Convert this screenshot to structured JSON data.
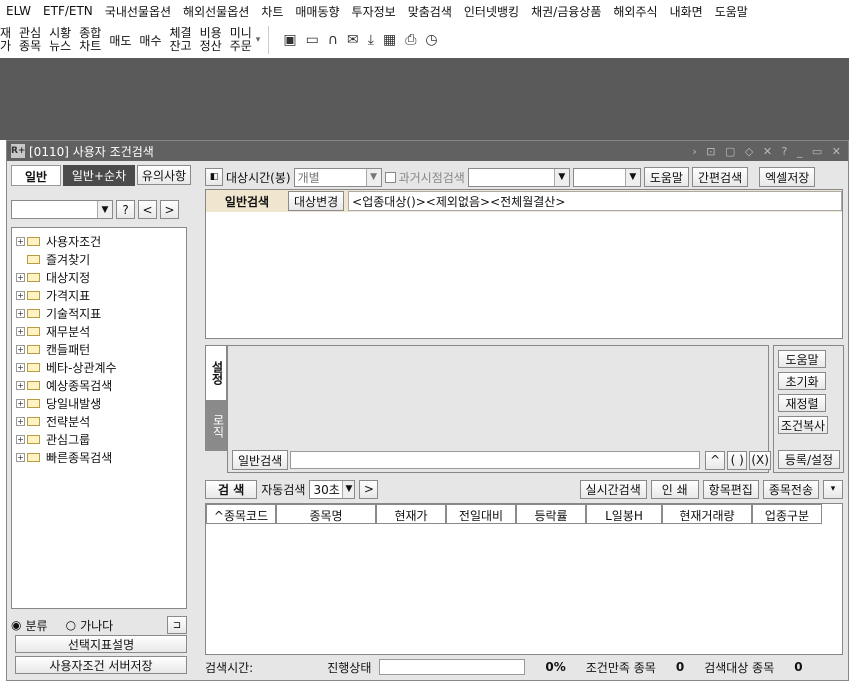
{
  "menu": [
    "ELW",
    "ETF/ETN",
    "국내선물옵션",
    "해외선물옵션",
    "차트",
    "매매동향",
    "투자정보",
    "맞춤검색",
    "인터넷뱅킹",
    "채권/금융상품",
    "해외주식",
    "내화면",
    "도움말"
  ],
  "toolbar": {
    "partial": "재\n가",
    "items": [
      "관심\n종목",
      "시황\n뉴스",
      "종합\n차트"
    ],
    "buy": "매도",
    "sell": "매수",
    "items2": [
      "체결\n잔고",
      "비용\n정산",
      "미니\n주문"
    ]
  },
  "window": {
    "title": "[0110] 사용자 조건검색",
    "logo": "R+",
    "controls": "› ⊡ ▢ ◇ ✕ ? _ ▭ ✕"
  },
  "left": {
    "tabs": [
      "일반",
      "일반+순차"
    ],
    "notice_btn": "유의사항",
    "help_q": "?",
    "nav_prev": "<",
    "nav_next": ">",
    "tree": [
      "사용자조건",
      "즐겨찾기",
      "대상지정",
      "가격지표",
      "기술적지표",
      "재무분석",
      "캔들패턴",
      "베타-상관계수",
      "예상종목검색",
      "당일내발생",
      "전략분석",
      "관심그룹",
      "빠른종목검색"
    ],
    "radio_a": "분류",
    "radio_b": "가나다",
    "btn_desc": "선택지표설명",
    "btn_save": "사용자조건 서버저장"
  },
  "top": {
    "target_time_label": "대상시간(봉)",
    "target_time_value": "개별",
    "past_search": "과거시점검색",
    "help": "도움말",
    "simple": "간편검색",
    "excel": "엑셀저장"
  },
  "cond": {
    "tab": "일반검색",
    "change": "대상변경",
    "text": "<업종대상()><제외없음><전체월결산>"
  },
  "settings": {
    "tab_set": "설정",
    "tab_logic": "로직",
    "general": "일반검색",
    "btns": [
      "도움말",
      "초기화",
      "재정렬",
      "조건복사"
    ],
    "register": "등록/설정",
    "paren": "( )",
    "excl": "(X)",
    "up": "^"
  },
  "search": {
    "search": "검 색",
    "auto": "자동검색",
    "interval": "30초",
    "realtime": "실시간검색",
    "print": "인 쇄",
    "edit": "항목편집",
    "send": "종목전송"
  },
  "columns": [
    "^종목코드",
    "종목명",
    "현재가",
    "전일대비",
    "등락률",
    "L일봉H",
    "현재거래량",
    "업종구분"
  ],
  "status": {
    "time_label": "검색시간:",
    "progress_label": "진행상태",
    "progress_pct": "0%",
    "match_label": "조건만족 종목",
    "match_count": "0",
    "target_label": "검색대상 종목",
    "target_count": "0"
  }
}
